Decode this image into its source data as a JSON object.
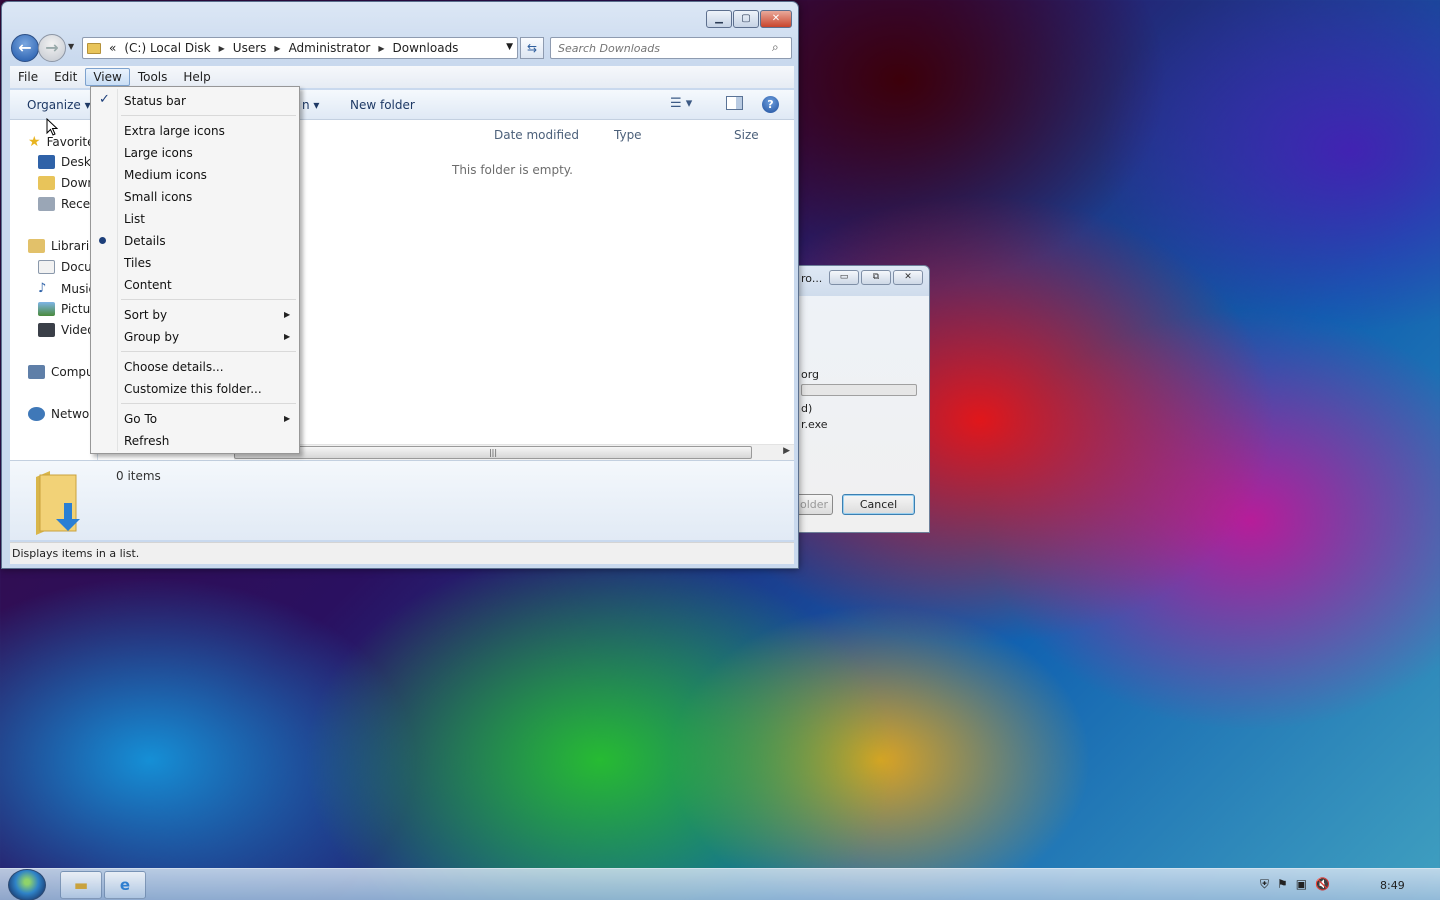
{
  "dialog": {
    "title": "ro...",
    "line1": "org",
    "line2": "d)",
    "line3": "r.exe",
    "folder_button": "older",
    "cancel_button": "Cancel"
  },
  "window": {
    "address": {
      "chevrons": "«",
      "crumbs": [
        "(C:) Local Disk",
        "Users",
        "Administrator",
        "Downloads"
      ]
    },
    "search_placeholder": "Search Downloads",
    "menubar": [
      "File",
      "Edit",
      "View",
      "Tools",
      "Help"
    ],
    "commandbar": {
      "organize": "Organize ▾",
      "partial_cmd": "n ▾",
      "new_folder": "New folder"
    },
    "navpane": {
      "favorites": "Favorite",
      "desktop": "Deskt",
      "downloads": "Down",
      "recent": "Recen",
      "libraries": "Librarie",
      "documents": "Docu",
      "music": "Music",
      "pictures": "Pictur",
      "videos": "Video",
      "computer": "Compu",
      "network": "Networ"
    },
    "columns": {
      "date_modified": "Date modified",
      "type": "Type",
      "size": "Size"
    },
    "empty_message": "This folder is empty.",
    "items_count": "0 items",
    "status_text": "Displays items in a list."
  },
  "view_menu": {
    "status_bar": "Status bar",
    "extra_large_icons": "Extra large icons",
    "large_icons": "Large icons",
    "medium_icons": "Medium icons",
    "small_icons": "Small icons",
    "list": "List",
    "details": "Details",
    "tiles": "Tiles",
    "content": "Content",
    "sort_by": "Sort by",
    "group_by": "Group by",
    "choose_details": "Choose details...",
    "customize_folder": "Customize this folder...",
    "go_to": "Go To",
    "refresh": "Refresh"
  },
  "taskbar": {
    "clock": "8:49"
  }
}
